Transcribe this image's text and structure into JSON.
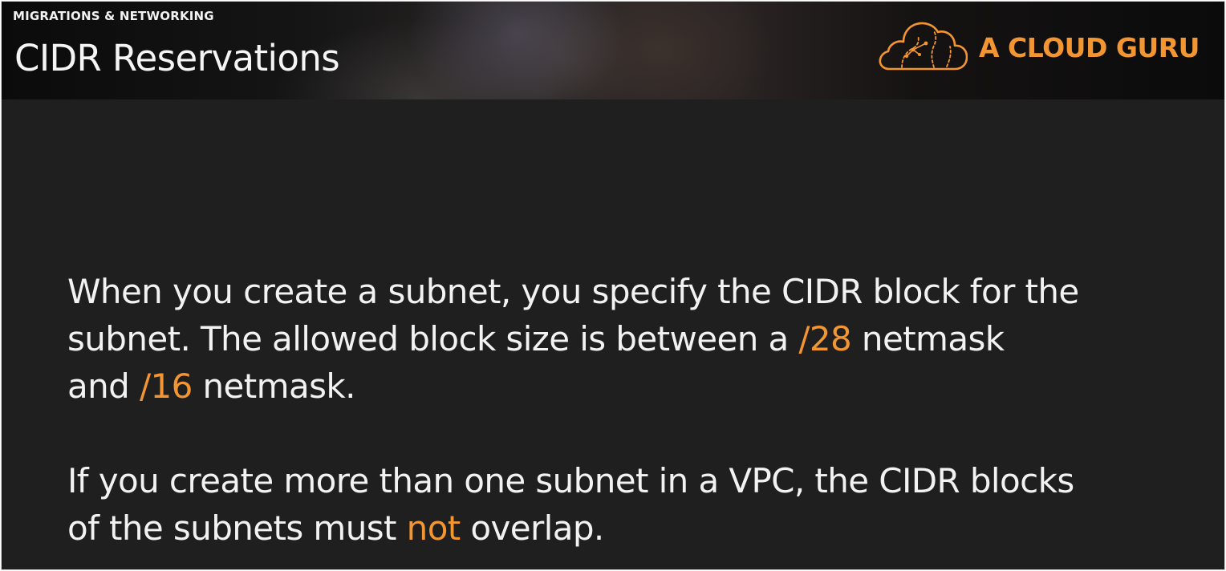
{
  "header": {
    "section_label": "MIGRATIONS & NETWORKING",
    "title": "CIDR Reservations",
    "brand": {
      "name": "A CLOUD GURU",
      "logo_icon": "cloud-guru-logo-icon",
      "color": "#f39631"
    }
  },
  "body": {
    "paragraph1": {
      "line1": "When you create a subnet, you specify the CIDR block for the",
      "line2_pre": "subnet. The allowed block size is between a ",
      "line2_hl": "/28",
      "line2_post": " netmask",
      "line3_pre": "and ",
      "line3_hl": "/16",
      "line3_post": " netmask."
    },
    "paragraph2": {
      "line1": "If you create more than one subnet in a VPC, the CIDR blocks",
      "line2_pre": "of the subnets must ",
      "line2_hl": "not",
      "line2_post": " overlap."
    }
  },
  "colors": {
    "background": "#1f1f1f",
    "text": "#f2f2f2",
    "accent": "#f39631"
  }
}
